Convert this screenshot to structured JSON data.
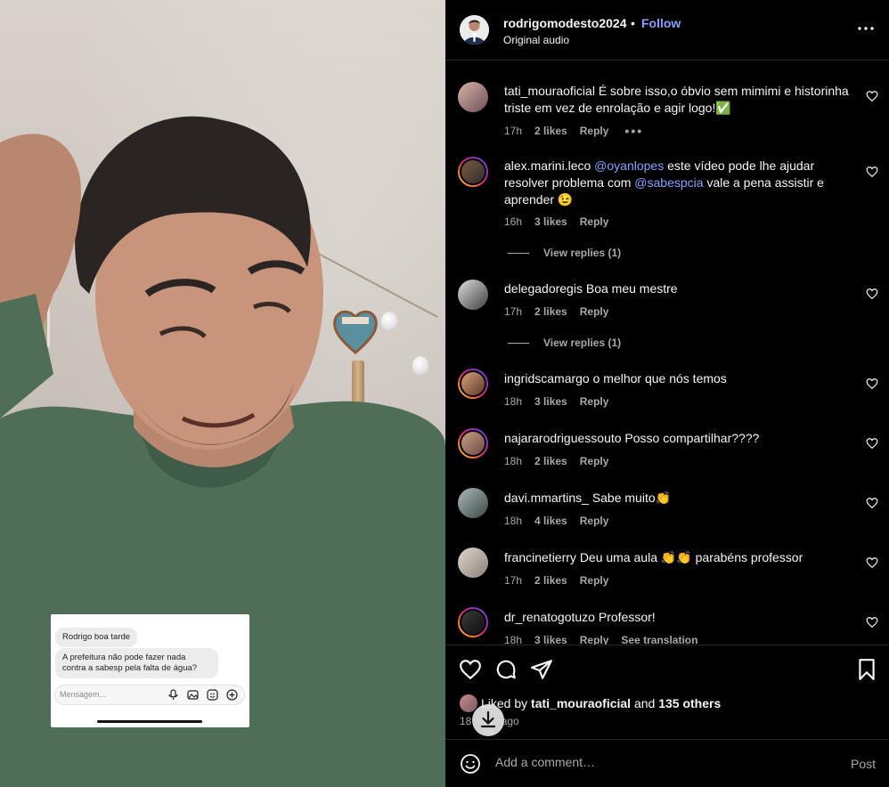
{
  "header": {
    "username": "rodrigomodesto2024",
    "separator": "•",
    "follow_label": "Follow",
    "audio_label": "Original audio",
    "more_icon": "more-horizontal-icon"
  },
  "media": {
    "chat_screenshot": {
      "message1": "Rodrigo boa tarde",
      "message2": "A prefeitura não pode fazer nada contra a sabesp pela falta de água?",
      "input_placeholder": "Mensagem..."
    }
  },
  "comments": [
    {
      "user": "tati_mouraoficial",
      "text": "É sobre isso,o óbvio sem mimimi e historinha triste em vez de enrolação e agir logo!✅",
      "time": "17h",
      "likes": "2 likes",
      "reply": "Reply",
      "more": "•••"
    },
    {
      "user": "alex.marini.leco",
      "mention1": "@oyanlopes",
      "text1": "este vídeo pode lhe ajudar resolver problema com",
      "mention2": "@sabespcia",
      "text2": "vale a pena assistir e aprender 😉",
      "time": "16h",
      "likes": "3 likes",
      "reply": "Reply",
      "view_replies": "View replies (1)"
    },
    {
      "user": "delegadoregis",
      "text": "Boa meu mestre",
      "time": "17h",
      "likes": "2 likes",
      "reply": "Reply",
      "view_replies": "View replies (1)"
    },
    {
      "user": "ingridscamargo",
      "text": "o melhor que nós temos",
      "time": "18h",
      "likes": "3 likes",
      "reply": "Reply"
    },
    {
      "user": "najararodriguessouto",
      "text": "Posso compartilhar????",
      "time": "18h",
      "likes": "2 likes",
      "reply": "Reply"
    },
    {
      "user": "davi.mmartins_",
      "text": "Sabe muito👏",
      "time": "18h",
      "likes": "4 likes",
      "reply": "Reply"
    },
    {
      "user": "francinetierry",
      "text": "Deu uma aula 👏👏 parabéns professor",
      "time": "17h",
      "likes": "2 likes",
      "reply": "Reply"
    },
    {
      "user": "dr_renatogotuzo",
      "text": "Professor!",
      "time": "18h",
      "likes": "3 likes",
      "reply": "Reply",
      "translation": "See translation"
    }
  ],
  "actions": {
    "liked_prefix": "Liked by",
    "liked_user": "tati_mouraoficial",
    "liked_and": "and",
    "liked_others": "135 others",
    "time_visible": "18",
    "time_suffix": "ago"
  },
  "add_comment": {
    "placeholder": "Add a comment…",
    "post_label": "Post"
  },
  "colors": {
    "link_blue": "#85a1ff",
    "secondary_text": "#a8a8a8",
    "background": "#000000"
  }
}
